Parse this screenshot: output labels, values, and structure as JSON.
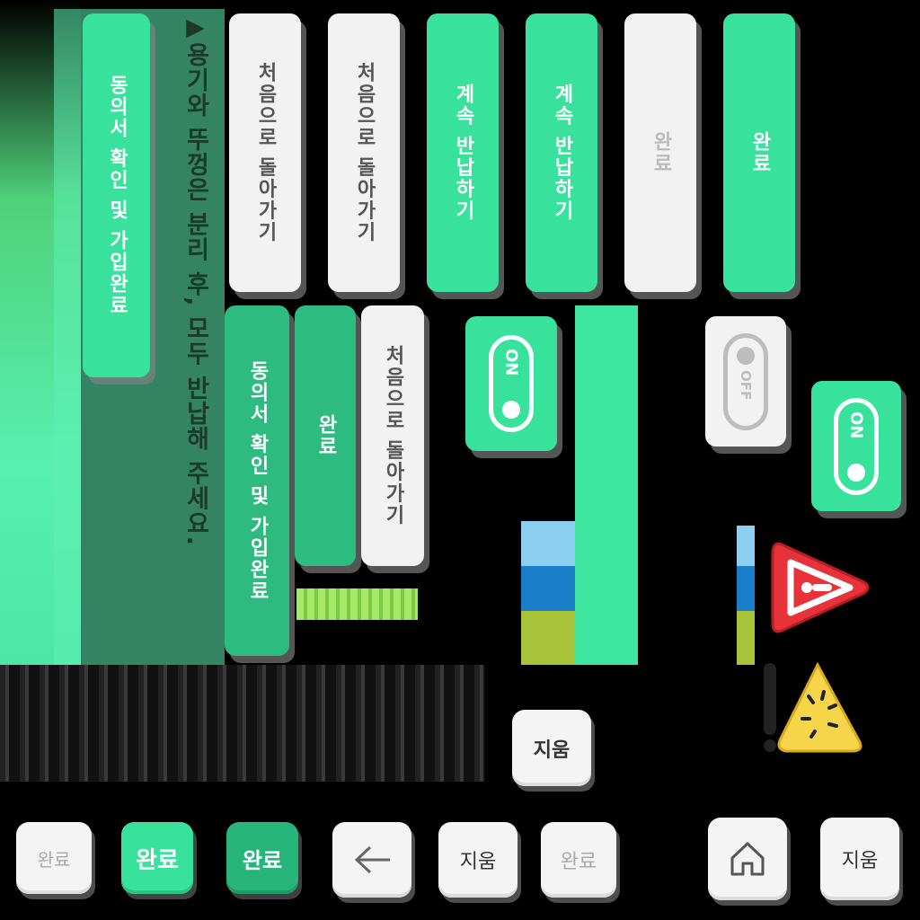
{
  "buttons": {
    "consent_confirm": "동의서 확인 및 가입완료",
    "warning_text": "▶용기와 뚜껑은 분리 후, 모두 반납해 주세요.",
    "go_home_1": "처음으로 돌아가기",
    "go_home_2": "처음으로 돌아가기",
    "continue_1": "계속 반납하기",
    "continue_2": "계속 반납하기",
    "done_gray": "완료",
    "done_green": "완료",
    "consent_confirm_dark": "동의서 확인 및 가입완료",
    "done_green_dark": "완료",
    "go_home_3": "처음으로 돌아가기"
  },
  "toggles": {
    "on_label": "ON",
    "off_label": "OFF"
  },
  "keys": {
    "erase_top": "지움",
    "done_light": "완료",
    "done_green": "완료",
    "done_dark": "완료",
    "erase_1": "지움",
    "done_light_2": "완료",
    "erase_2": "지움"
  },
  "icons": {
    "back": "arrow-left-icon",
    "home": "home-icon",
    "alert": "warning-triangle-red-icon",
    "alert2": "warning-triangle-yellow-icon"
  },
  "colors": {
    "green": "#38e29c",
    "green_dark": "#27b57c",
    "gray": "#f2f2f2",
    "red": "#e8323a",
    "yellow": "#f7d54a"
  }
}
